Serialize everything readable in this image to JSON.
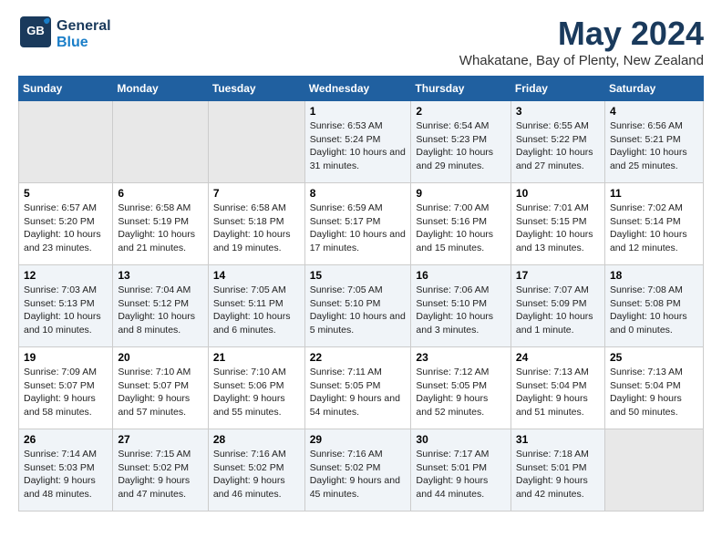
{
  "logo": {
    "general": "General",
    "blue": "Blue"
  },
  "title": "May 2024",
  "subtitle": "Whakatane, Bay of Plenty, New Zealand",
  "days_header": [
    "Sunday",
    "Monday",
    "Tuesday",
    "Wednesday",
    "Thursday",
    "Friday",
    "Saturday"
  ],
  "weeks": [
    [
      {
        "num": "",
        "content": "",
        "empty": true
      },
      {
        "num": "",
        "content": "",
        "empty": true
      },
      {
        "num": "",
        "content": "",
        "empty": true
      },
      {
        "num": "1",
        "sunrise": "6:53 AM",
        "sunset": "5:24 PM",
        "daylight": "10 hours and 31 minutes."
      },
      {
        "num": "2",
        "sunrise": "6:54 AM",
        "sunset": "5:23 PM",
        "daylight": "10 hours and 29 minutes."
      },
      {
        "num": "3",
        "sunrise": "6:55 AM",
        "sunset": "5:22 PM",
        "daylight": "10 hours and 27 minutes."
      },
      {
        "num": "4",
        "sunrise": "6:56 AM",
        "sunset": "5:21 PM",
        "daylight": "10 hours and 25 minutes."
      }
    ],
    [
      {
        "num": "5",
        "sunrise": "6:57 AM",
        "sunset": "5:20 PM",
        "daylight": "10 hours and 23 minutes."
      },
      {
        "num": "6",
        "sunrise": "6:58 AM",
        "sunset": "5:19 PM",
        "daylight": "10 hours and 21 minutes."
      },
      {
        "num": "7",
        "sunrise": "6:58 AM",
        "sunset": "5:18 PM",
        "daylight": "10 hours and 19 minutes."
      },
      {
        "num": "8",
        "sunrise": "6:59 AM",
        "sunset": "5:17 PM",
        "daylight": "10 hours and 17 minutes."
      },
      {
        "num": "9",
        "sunrise": "7:00 AM",
        "sunset": "5:16 PM",
        "daylight": "10 hours and 15 minutes."
      },
      {
        "num": "10",
        "sunrise": "7:01 AM",
        "sunset": "5:15 PM",
        "daylight": "10 hours and 13 minutes."
      },
      {
        "num": "11",
        "sunrise": "7:02 AM",
        "sunset": "5:14 PM",
        "daylight": "10 hours and 12 minutes."
      }
    ],
    [
      {
        "num": "12",
        "sunrise": "7:03 AM",
        "sunset": "5:13 PM",
        "daylight": "10 hours and 10 minutes."
      },
      {
        "num": "13",
        "sunrise": "7:04 AM",
        "sunset": "5:12 PM",
        "daylight": "10 hours and 8 minutes."
      },
      {
        "num": "14",
        "sunrise": "7:05 AM",
        "sunset": "5:11 PM",
        "daylight": "10 hours and 6 minutes."
      },
      {
        "num": "15",
        "sunrise": "7:05 AM",
        "sunset": "5:10 PM",
        "daylight": "10 hours and 5 minutes."
      },
      {
        "num": "16",
        "sunrise": "7:06 AM",
        "sunset": "5:10 PM",
        "daylight": "10 hours and 3 minutes."
      },
      {
        "num": "17",
        "sunrise": "7:07 AM",
        "sunset": "5:09 PM",
        "daylight": "10 hours and 1 minute."
      },
      {
        "num": "18",
        "sunrise": "7:08 AM",
        "sunset": "5:08 PM",
        "daylight": "10 hours and 0 minutes."
      }
    ],
    [
      {
        "num": "19",
        "sunrise": "7:09 AM",
        "sunset": "5:07 PM",
        "daylight": "9 hours and 58 minutes."
      },
      {
        "num": "20",
        "sunrise": "7:10 AM",
        "sunset": "5:07 PM",
        "daylight": "9 hours and 57 minutes."
      },
      {
        "num": "21",
        "sunrise": "7:10 AM",
        "sunset": "5:06 PM",
        "daylight": "9 hours and 55 minutes."
      },
      {
        "num": "22",
        "sunrise": "7:11 AM",
        "sunset": "5:05 PM",
        "daylight": "9 hours and 54 minutes."
      },
      {
        "num": "23",
        "sunrise": "7:12 AM",
        "sunset": "5:05 PM",
        "daylight": "9 hours and 52 minutes."
      },
      {
        "num": "24",
        "sunrise": "7:13 AM",
        "sunset": "5:04 PM",
        "daylight": "9 hours and 51 minutes."
      },
      {
        "num": "25",
        "sunrise": "7:13 AM",
        "sunset": "5:04 PM",
        "daylight": "9 hours and 50 minutes."
      }
    ],
    [
      {
        "num": "26",
        "sunrise": "7:14 AM",
        "sunset": "5:03 PM",
        "daylight": "9 hours and 48 minutes."
      },
      {
        "num": "27",
        "sunrise": "7:15 AM",
        "sunset": "5:02 PM",
        "daylight": "9 hours and 47 minutes."
      },
      {
        "num": "28",
        "sunrise": "7:16 AM",
        "sunset": "5:02 PM",
        "daylight": "9 hours and 46 minutes."
      },
      {
        "num": "29",
        "sunrise": "7:16 AM",
        "sunset": "5:02 PM",
        "daylight": "9 hours and 45 minutes."
      },
      {
        "num": "30",
        "sunrise": "7:17 AM",
        "sunset": "5:01 PM",
        "daylight": "9 hours and 44 minutes."
      },
      {
        "num": "31",
        "sunrise": "7:18 AM",
        "sunset": "5:01 PM",
        "daylight": "9 hours and 42 minutes."
      },
      {
        "num": "",
        "content": "",
        "empty": true
      }
    ]
  ]
}
